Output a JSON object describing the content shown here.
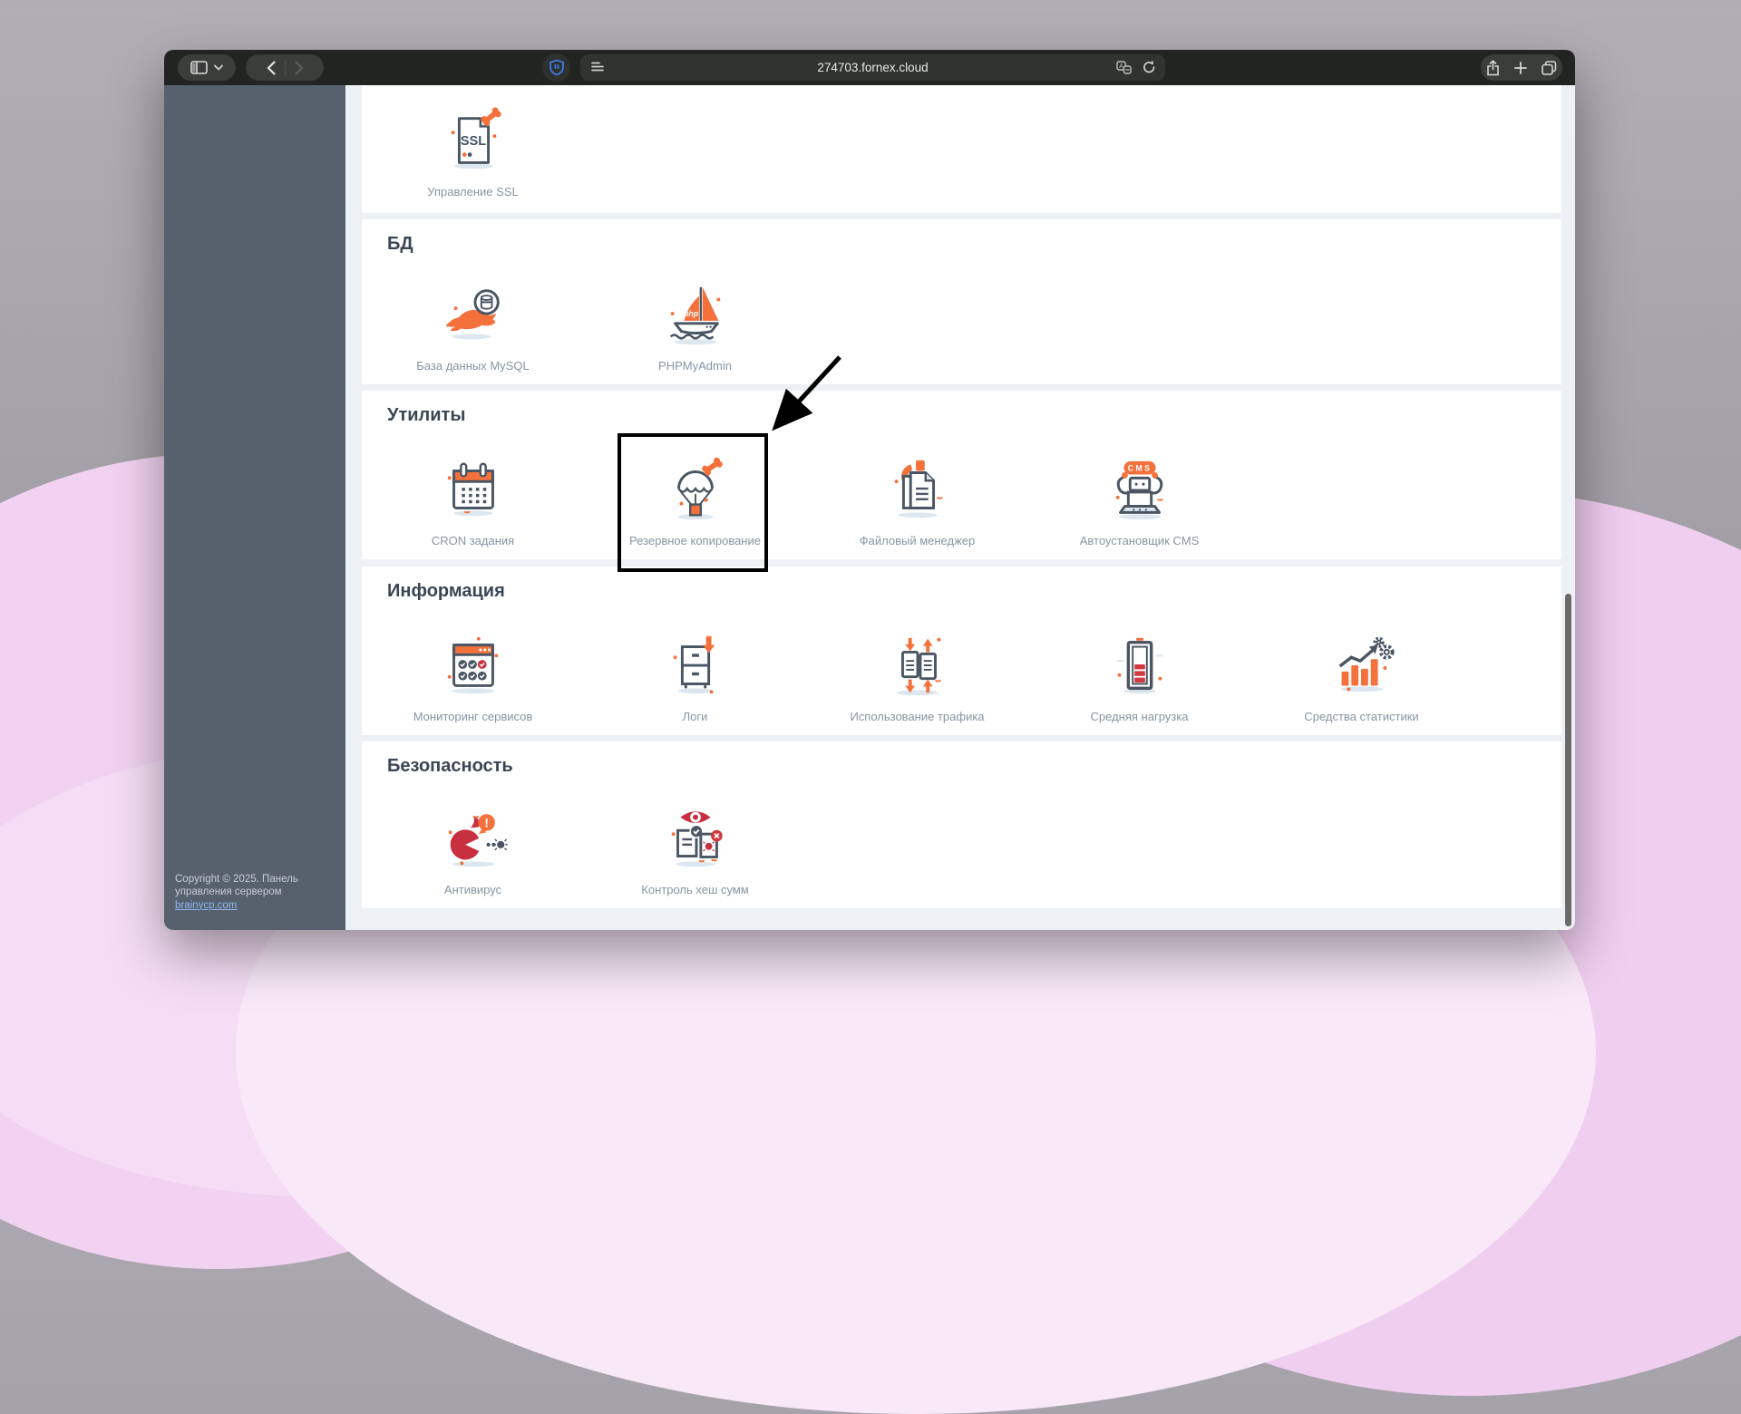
{
  "browser": {
    "url": "274703.fornex.cloud",
    "toolbar": {
      "left_icons": [
        "sidebar-toggle-icon",
        "chevron-down-icon",
        "back-icon",
        "forward-icon"
      ],
      "url_icons": [
        "shield-icon",
        "reader-view-icon",
        "translate-icon",
        "reload-icon"
      ],
      "right_icons": [
        "share-icon",
        "new-tab-icon",
        "tab-overview-icon"
      ]
    }
  },
  "sidebar": {
    "copyright_text": "Copyright © 2025. Панель управления сервером",
    "copyright_link": "brainycp.com"
  },
  "sections": [
    {
      "title": "",
      "items": [
        {
          "label": "Управление SSL",
          "icon": "ssl-certificate"
        }
      ]
    },
    {
      "title": "БД",
      "items": [
        {
          "label": "База данных MySQL",
          "icon": "mysql-database"
        },
        {
          "label": "PHPMyAdmin",
          "icon": "phpmyadmin-boat"
        }
      ]
    },
    {
      "title": "Утилиты",
      "items": [
        {
          "label": "CRON задания",
          "icon": "cron-calendar"
        },
        {
          "label": "Резервное копирование",
          "icon": "backup-parachute",
          "highlighted": true
        },
        {
          "label": "Файловый менеджер",
          "icon": "file-manager"
        },
        {
          "label": "Автоустановщик CMS",
          "icon": "cms-installer"
        }
      ]
    },
    {
      "title": "Информация",
      "items": [
        {
          "label": "Мониторинг сервисов",
          "icon": "service-monitoring"
        },
        {
          "label": "Логи",
          "icon": "logs-drawer"
        },
        {
          "label": "Использование трафика",
          "icon": "traffic-usage"
        },
        {
          "label": "Средняя нагрузка",
          "icon": "load-average"
        },
        {
          "label": "Средства статистики",
          "icon": "statistics-tools"
        }
      ]
    },
    {
      "title": "Безопасность",
      "items": [
        {
          "label": "Антивирус",
          "icon": "antivirus"
        },
        {
          "label": "Контроль хеш сумм",
          "icon": "hash-sum-control"
        }
      ]
    }
  ],
  "annotation": {
    "type": "rectangle-with-arrow",
    "target": "Резервное копирование"
  },
  "colors": {
    "accent_orange": "#f4713c",
    "outline_dark": "#4a5663",
    "status_red": "#c9303f",
    "sidebar_bg": "#57616d",
    "link_blue": "#8db6f0"
  }
}
